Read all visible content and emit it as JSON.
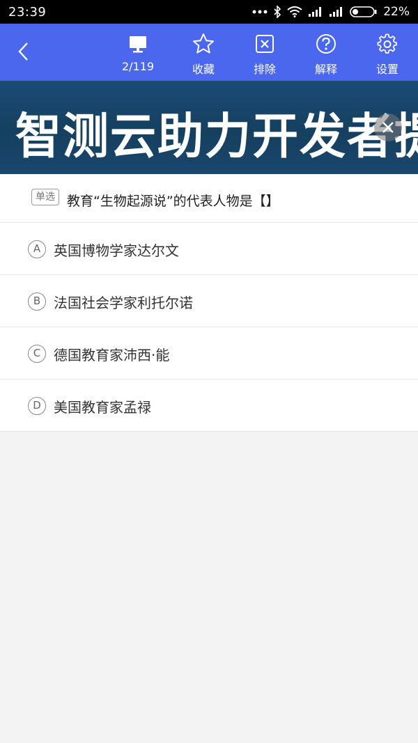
{
  "status_bar": {
    "time": "23:39",
    "battery": "22%",
    "icons": [
      "more-dots-icon",
      "bluetooth-icon",
      "wifi-icon",
      "signal-icon",
      "signal-icon",
      "battery-icon"
    ]
  },
  "toolbar": {
    "progress": "2/119",
    "favorite_label": "收藏",
    "exclude_label": "排除",
    "explain_label": "解释",
    "settings_label": "设置"
  },
  "banner": {
    "text": "智测云助力开发者提"
  },
  "question": {
    "tag": "单选",
    "text": "教育“生物起源说”的代表人物是【】",
    "options": [
      {
        "letter": "A",
        "text": "英国博物学家达尔文"
      },
      {
        "letter": "B",
        "text": "法国社会学家利托尔诺"
      },
      {
        "letter": "C",
        "text": "德国教育家沛西·能"
      },
      {
        "letter": "D",
        "text": "美国教育家孟禄"
      }
    ]
  },
  "colors": {
    "toolbar": "#4a67ee",
    "banner": "#1b4a76",
    "background": "#f3f3f3"
  }
}
